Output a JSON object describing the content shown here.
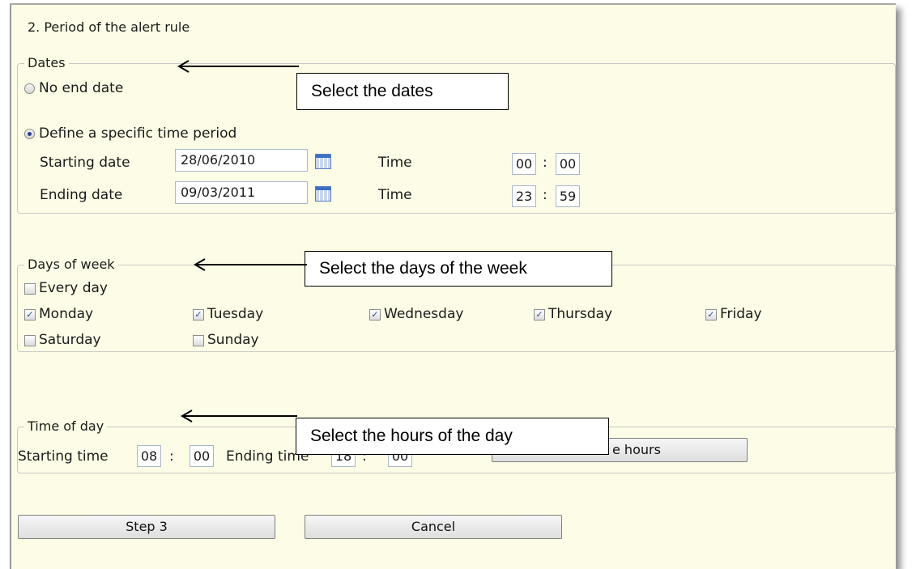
{
  "section_title": "2. Period of the alert rule",
  "dates": {
    "legend": "Dates",
    "no_end_date_label": "No end date",
    "specific_period_label": "Define a specific time period",
    "starting_date_label": "Starting date",
    "starting_date_value": "28/06/2010",
    "ending_date_label": "Ending date",
    "ending_date_value": "09/03/2011",
    "time_label": "Time",
    "start_hour": "00",
    "start_minute": "00",
    "end_hour": "23",
    "end_minute": "59",
    "colon": ":"
  },
  "days": {
    "legend": "Days of week",
    "every_day": "Every day",
    "monday": "Monday",
    "tuesday": "Tuesday",
    "wednesday": "Wednesday",
    "thursday": "Thursday",
    "friday": "Friday",
    "saturday": "Saturday",
    "sunday": "Sunday",
    "check_mark": "✓"
  },
  "time_of_day": {
    "legend": "Time of day",
    "starting_time_label": "Starting time",
    "start_hour": "08",
    "start_minute": "00",
    "ending_time_label": "Ending time",
    "end_hour": "18",
    "end_minute": "00",
    "colon": ":",
    "hours_button_label": "e hours"
  },
  "buttons": {
    "step3": "Step 3",
    "cancel": "Cancel"
  },
  "callouts": {
    "dates": "Select the dates",
    "days": "Select the days of the week",
    "hours": "Select the hours of the day"
  },
  "colors": {
    "panel_background": "#fdfde7",
    "check_color": "#2d4fa3"
  }
}
